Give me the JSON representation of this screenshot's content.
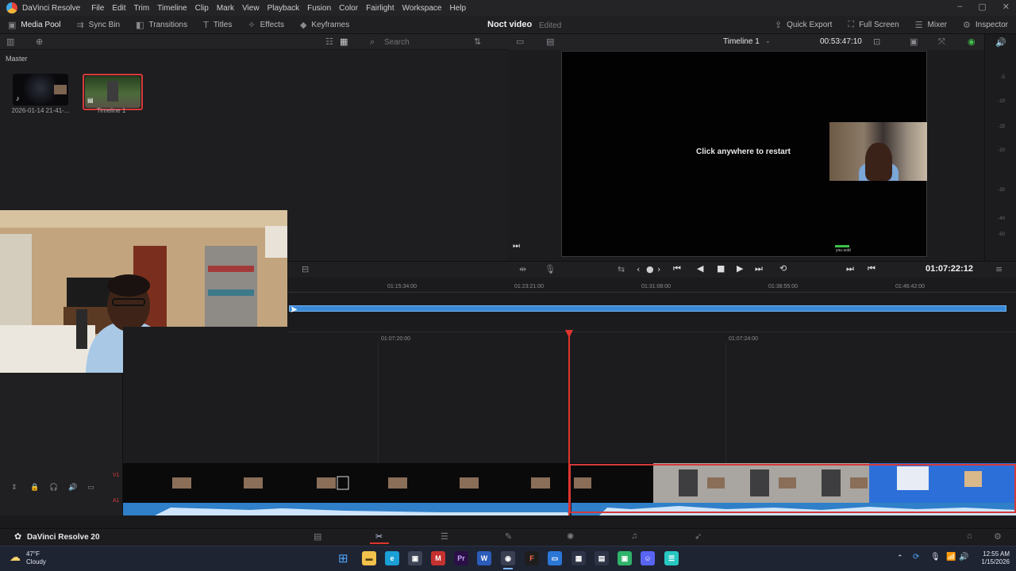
{
  "menu": {
    "app_name": "DaVinci Resolve",
    "items": [
      "File",
      "Edit",
      "Trim",
      "Timeline",
      "Clip",
      "Mark",
      "View",
      "Playback",
      "Fusion",
      "Color",
      "Fairlight",
      "Workspace",
      "Help"
    ]
  },
  "toolbar": {
    "media_pool": "Media Pool",
    "sync_bin": "Sync Bin",
    "transitions": "Transitions",
    "titles": "Titles",
    "effects": "Effects",
    "keyframes": "Keyframes",
    "project_title": "Noct video",
    "project_status": "Edited",
    "quick_export": "Quick Export",
    "full_screen": "Full Screen",
    "mixer": "Mixer",
    "inspector": "Inspector"
  },
  "pool": {
    "search_placeholder": "Search",
    "bin_name": "Master",
    "clips": [
      {
        "caption": "2026-01-14 21-41-..."
      },
      {
        "caption": "Timeline 1"
      }
    ]
  },
  "viewer": {
    "timeline_name": "Timeline 1",
    "duration": "00:53:47:10",
    "overlay_text": "Click anywhere to restart",
    "done_text": "you sold",
    "meter_ticks": [
      "-5",
      "-10",
      "-15",
      "-20",
      "-30",
      "-40",
      "-50"
    ]
  },
  "transport": {
    "timecode": "01:07:22:12"
  },
  "upper_timeline": {
    "labels": [
      "01:15:34:00",
      "01:23:21:00",
      "01:31:08:00",
      "01:38:55:00",
      "01:46:42:00"
    ]
  },
  "lower_timeline": {
    "labels": [
      "01:07:20:00",
      "01:07:24:00"
    ],
    "track_v": "V1",
    "track_a": "A1"
  },
  "pagebar": {
    "brand": "DaVinci Resolve 20"
  },
  "taskbar": {
    "temperature": "47°F",
    "condition": "Cloudy",
    "time": "12:55 AM",
    "date": "1/15/2026",
    "apps": [
      "Pr",
      "W",
      "F"
    ]
  },
  "colors": {
    "accent_blue": "#3a8ad8",
    "playhead_red": "#e0332e",
    "selection_red": "#d43a3a"
  }
}
